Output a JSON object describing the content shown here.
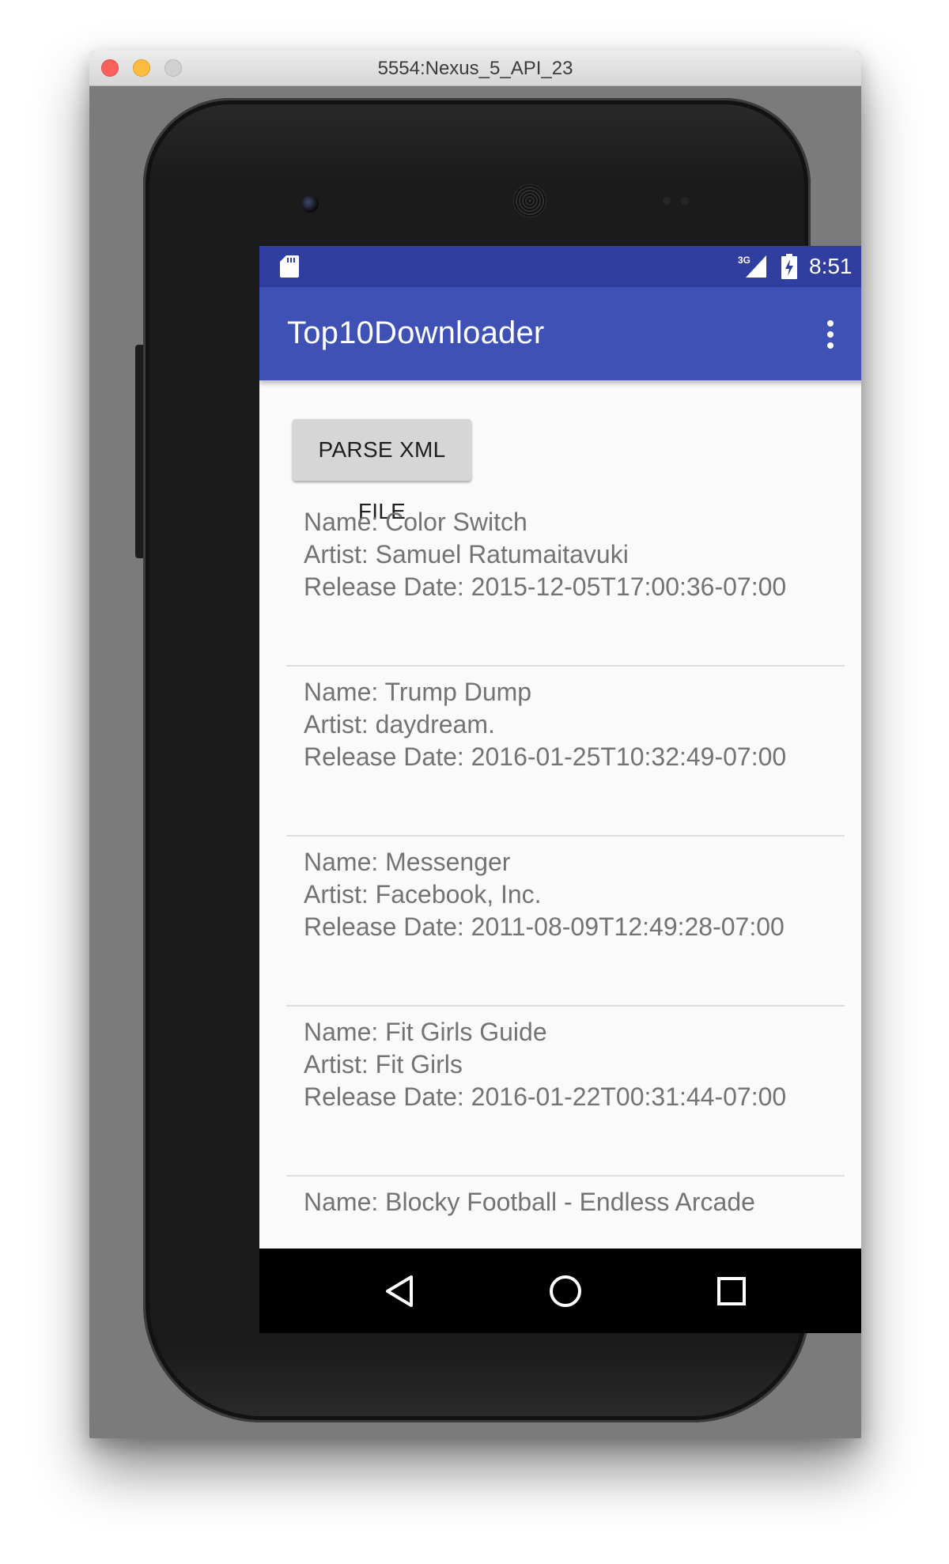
{
  "window": {
    "title": "5554:Nexus_5_API_23"
  },
  "status_bar": {
    "time": "8:51",
    "network": "3G",
    "icons": [
      "sd-card-icon",
      "signal-icon",
      "battery-icon"
    ]
  },
  "app_bar": {
    "title": "Top10Downloader",
    "menu_icon": "more-vert-icon"
  },
  "main": {
    "parse_button_label": "PARSE XML FILE",
    "items": [
      {
        "name": "Name: Color Switch",
        "artist": "Artist: Samuel Ratumaitavuki",
        "release": "Release Date: 2015-12-05T17:00:36-07:00"
      },
      {
        "name": "Name: Trump Dump",
        "artist": "Artist: daydream.",
        "release": "Release Date: 2016-01-25T10:32:49-07:00"
      },
      {
        "name": "Name: Messenger",
        "artist": "Artist: Facebook, Inc.",
        "release": "Release Date: 2011-08-09T12:49:28-07:00"
      },
      {
        "name": "Name: Fit Girls Guide",
        "artist": "Artist: Fit Girls",
        "release": "Release Date: 2016-01-22T00:31:44-07:00"
      },
      {
        "name": "Name: Blocky Football - Endless Arcade"
      }
    ]
  },
  "nav_bar": {
    "buttons": [
      "back-icon",
      "home-icon",
      "recents-icon"
    ]
  },
  "colors": {
    "status_bar": "#303f9f",
    "app_bar": "#3f51b5",
    "background": "#fafafa",
    "item_text": "#737373"
  }
}
